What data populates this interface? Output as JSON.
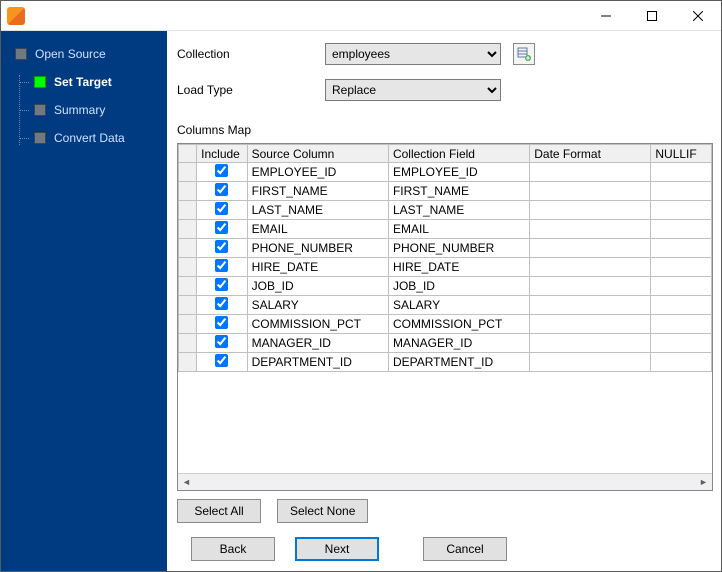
{
  "sidebar": {
    "items": [
      {
        "label": "Open Source",
        "active": false,
        "marker": "gray"
      },
      {
        "label": "Set Target",
        "active": true,
        "marker": "green"
      },
      {
        "label": "Summary",
        "active": false,
        "marker": "gray"
      },
      {
        "label": "Convert Data",
        "active": false,
        "marker": "gray"
      }
    ]
  },
  "form": {
    "collection_label": "Collection",
    "collection_value": "employees",
    "loadtype_label": "Load Type",
    "loadtype_value": "Replace"
  },
  "columns_map_label": "Columns Map",
  "grid": {
    "headers": {
      "include": "Include",
      "source": "Source Column",
      "field": "Collection Field",
      "dateformat": "Date Format",
      "nullif": "NULLIF"
    },
    "rows": [
      {
        "include": true,
        "source": "EMPLOYEE_ID",
        "field": "EMPLOYEE_ID",
        "dateformat": "",
        "nullif": ""
      },
      {
        "include": true,
        "source": "FIRST_NAME",
        "field": "FIRST_NAME",
        "dateformat": "",
        "nullif": ""
      },
      {
        "include": true,
        "source": "LAST_NAME",
        "field": "LAST_NAME",
        "dateformat": "",
        "nullif": ""
      },
      {
        "include": true,
        "source": "EMAIL",
        "field": "EMAIL",
        "dateformat": "",
        "nullif": ""
      },
      {
        "include": true,
        "source": "PHONE_NUMBER",
        "field": "PHONE_NUMBER",
        "dateformat": "",
        "nullif": ""
      },
      {
        "include": true,
        "source": "HIRE_DATE",
        "field": "HIRE_DATE",
        "dateformat": "",
        "nullif": ""
      },
      {
        "include": true,
        "source": "JOB_ID",
        "field": "JOB_ID",
        "dateformat": "",
        "nullif": ""
      },
      {
        "include": true,
        "source": "SALARY",
        "field": "SALARY",
        "dateformat": "",
        "nullif": ""
      },
      {
        "include": true,
        "source": "COMMISSION_PCT",
        "field": "COMMISSION_PCT",
        "dateformat": "",
        "nullif": ""
      },
      {
        "include": true,
        "source": "MANAGER_ID",
        "field": "MANAGER_ID",
        "dateformat": "",
        "nullif": ""
      },
      {
        "include": true,
        "source": "DEPARTMENT_ID",
        "field": "DEPARTMENT_ID",
        "dateformat": "",
        "nullif": ""
      }
    ]
  },
  "buttons": {
    "select_all": "Select All",
    "select_none": "Select None",
    "back": "Back",
    "next": "Next",
    "cancel": "Cancel"
  }
}
